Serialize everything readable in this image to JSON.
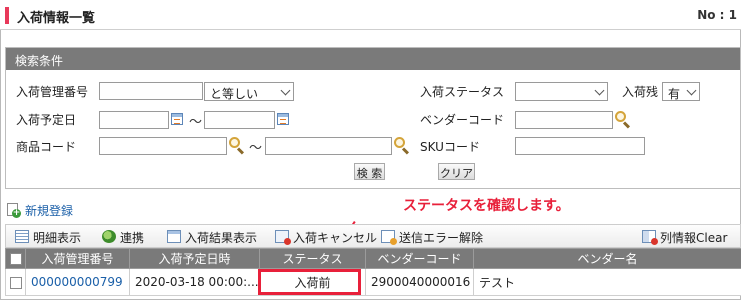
{
  "header": {
    "title": "入荷情報一覧",
    "number_label": "No : 1"
  },
  "search": {
    "title": "検索条件",
    "fields": {
      "arrival_no_label": "入荷管理番号",
      "arrival_no_operator": "と等しい",
      "arrival_status_label": "入荷ステータス",
      "arrival_status_value": "",
      "remaining_label": "入荷残",
      "remaining_value": "有",
      "arrival_date_label": "入荷予定日",
      "range_sep": "～",
      "vendor_code_label": "ベンダーコード",
      "product_code_label": "商品コード",
      "sku_code_label": "SKUコード"
    },
    "search_button": "検 索",
    "clear_button": "クリア"
  },
  "new_registration": "新規登録",
  "annotation": {
    "text": "ステータスを確認します。",
    "color": "#e8203a"
  },
  "toolbar": {
    "detail": "明細表示",
    "link": "連携",
    "result": "入荷結果表示",
    "cancel": "入荷キャンセル",
    "error_clear": "送信エラー解除",
    "column_clear": "列情報Clear"
  },
  "table": {
    "columns": [
      "入荷管理番号",
      "入荷予定日時",
      "ステータス",
      "ベンダーコード",
      "ベンダー名"
    ],
    "rows": [
      {
        "arrival_no": "000000000799",
        "scheduled": "2020-03-18 00:00:...",
        "status": "入荷前",
        "vendor_code": "2900040000016",
        "vendor_name": "テスト"
      }
    ]
  },
  "colors": {
    "accent": "#e8395a",
    "header_gray": "#7a7a7a",
    "link": "#1a5fa8"
  }
}
